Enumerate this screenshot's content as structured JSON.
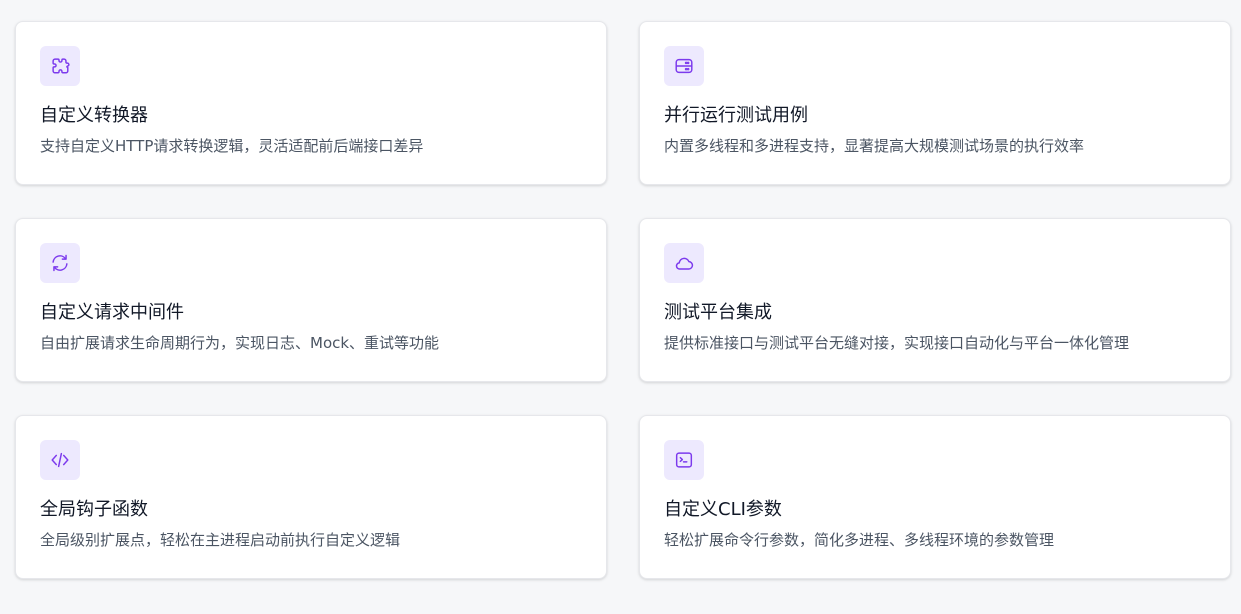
{
  "features": [
    {
      "icon": "puzzle-icon",
      "title": "自定义转换器",
      "description": "支持自定义HTTP请求转换逻辑，灵活适配前后端接口差异"
    },
    {
      "icon": "server-icon",
      "title": "并行运行测试用例",
      "description": "内置多线程和多进程支持，显著提高大规模测试场景的执行效率"
    },
    {
      "icon": "refresh-icon",
      "title": "自定义请求中间件",
      "description": "自由扩展请求生命周期行为，实现日志、Mock、重试等功能"
    },
    {
      "icon": "cloud-icon",
      "title": "测试平台集成",
      "description": "提供标准接口与测试平台无缝对接，实现接口自动化与平台一体化管理"
    },
    {
      "icon": "code-icon",
      "title": "全局钩子函数",
      "description": "全局级别扩展点，轻松在主进程启动前执行自定义逻辑"
    },
    {
      "icon": "terminal-icon",
      "title": "自定义CLI参数",
      "description": "轻松扩展命令行参数，简化多进程、多线程环境的参数管理"
    }
  ],
  "colors": {
    "accent": "#7c3aed",
    "icon_background": "#ede9fe",
    "page_background": "#f6f7f9"
  }
}
